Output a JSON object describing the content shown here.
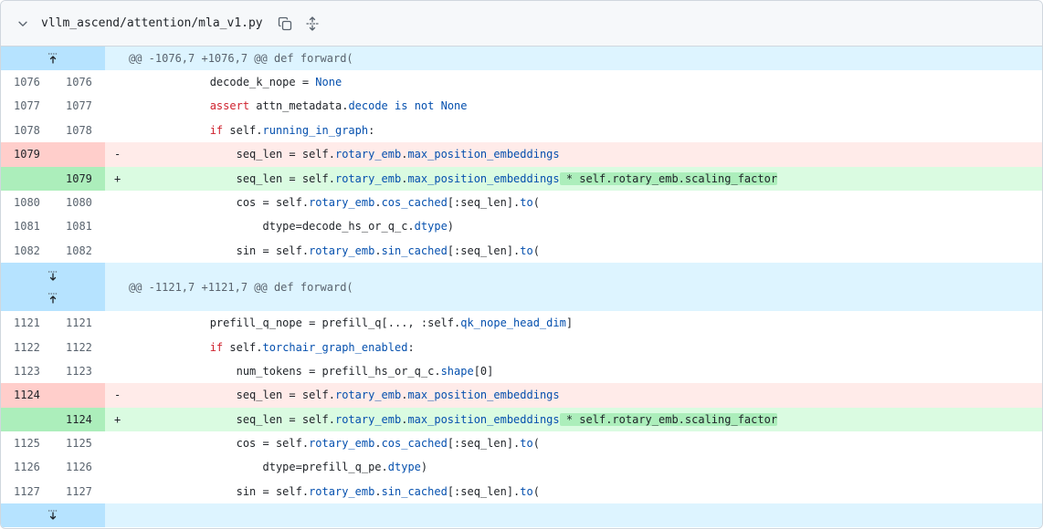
{
  "file": {
    "path": "vllm_ascend/attention/mla_v1.py"
  },
  "icons": {
    "collapse": "chevron-down-icon",
    "copy": "copy-icon",
    "expand": "unfold-icon"
  },
  "hunks": [
    {
      "header": "@@ -1076,7 +1076,7 @@ def forward(",
      "lines": [
        {
          "type": "ctx",
          "old": "1076",
          "new": "1076",
          "sign": "",
          "parts": [
            [
              "",
              "            decode_k_nope "
            ],
            [
              "",
              "= "
            ],
            [
              "bl",
              "None"
            ]
          ]
        },
        {
          "type": "ctx",
          "old": "1077",
          "new": "1077",
          "sign": "",
          "parts": [
            [
              "",
              "            "
            ],
            [
              "kw",
              "assert"
            ],
            [
              "",
              " attn_metadata."
            ],
            [
              "bl",
              "decode"
            ],
            [
              "",
              " "
            ],
            [
              "bl",
              "is not None"
            ]
          ]
        },
        {
          "type": "ctx",
          "old": "1078",
          "new": "1078",
          "sign": "",
          "parts": [
            [
              "",
              "            "
            ],
            [
              "kw",
              "if"
            ],
            [
              "",
              " self."
            ],
            [
              "bl",
              "running_in_graph"
            ],
            [
              "",
              ":"
            ]
          ]
        },
        {
          "type": "del",
          "old": "1079",
          "new": "",
          "sign": "-",
          "parts": [
            [
              "",
              "                seq_len = self."
            ],
            [
              "bl",
              "rotary_emb"
            ],
            [
              "",
              "."
            ],
            [
              "bl",
              "max_position_embeddings"
            ]
          ]
        },
        {
          "type": "add",
          "old": "",
          "new": "1079",
          "sign": "+",
          "parts": [
            [
              "",
              "                seq_len = self."
            ],
            [
              "bl",
              "rotary_emb"
            ],
            [
              "",
              "."
            ],
            [
              "bl",
              "max_position_embeddings"
            ],
            [
              "hl",
              " * self.rotary_emb.scaling_factor"
            ]
          ]
        },
        {
          "type": "ctx",
          "old": "1080",
          "new": "1080",
          "sign": "",
          "parts": [
            [
              "",
              "                cos = self."
            ],
            [
              "bl",
              "rotary_emb"
            ],
            [
              "",
              "."
            ],
            [
              "bl",
              "cos_cached"
            ],
            [
              "",
              "[:seq_len]."
            ],
            [
              "bl",
              "to"
            ],
            [
              "",
              "("
            ]
          ]
        },
        {
          "type": "ctx",
          "old": "1081",
          "new": "1081",
          "sign": "",
          "parts": [
            [
              "",
              "                    dtype=decode_hs_or_q_c."
            ],
            [
              "bl",
              "dtype"
            ],
            [
              "",
              ")"
            ]
          ]
        },
        {
          "type": "ctx",
          "old": "1082",
          "new": "1082",
          "sign": "",
          "parts": [
            [
              "",
              "                sin = self."
            ],
            [
              "bl",
              "rotary_emb"
            ],
            [
              "",
              "."
            ],
            [
              "bl",
              "sin_cached"
            ],
            [
              "",
              "[:seq_len]."
            ],
            [
              "bl",
              "to"
            ],
            [
              "",
              "("
            ]
          ]
        }
      ]
    },
    {
      "header": "@@ -1121,7 +1121,7 @@ def forward(",
      "lines": [
        {
          "type": "ctx",
          "old": "1121",
          "new": "1121",
          "sign": "",
          "parts": [
            [
              "",
              "            prefill_q_nope = prefill_q[..., :self."
            ],
            [
              "bl",
              "qk_nope_head_dim"
            ],
            [
              "",
              "]"
            ]
          ]
        },
        {
          "type": "ctx",
          "old": "1122",
          "new": "1122",
          "sign": "",
          "parts": [
            [
              "",
              "            "
            ],
            [
              "kw",
              "if"
            ],
            [
              "",
              " self."
            ],
            [
              "bl",
              "torchair_graph_enabled"
            ],
            [
              "",
              ":"
            ]
          ]
        },
        {
          "type": "ctx",
          "old": "1123",
          "new": "1123",
          "sign": "",
          "parts": [
            [
              "",
              "                num_tokens = prefill_hs_or_q_c."
            ],
            [
              "bl",
              "shape"
            ],
            [
              "",
              "[0]"
            ]
          ]
        },
        {
          "type": "del",
          "old": "1124",
          "new": "",
          "sign": "-",
          "parts": [
            [
              "",
              "                seq_len = self."
            ],
            [
              "bl",
              "rotary_emb"
            ],
            [
              "",
              "."
            ],
            [
              "bl",
              "max_position_embeddings"
            ]
          ]
        },
        {
          "type": "add",
          "old": "",
          "new": "1124",
          "sign": "+",
          "parts": [
            [
              "",
              "                seq_len = self."
            ],
            [
              "bl",
              "rotary_emb"
            ],
            [
              "",
              "."
            ],
            [
              "bl",
              "max_position_embeddings"
            ],
            [
              "hl",
              " * self.rotary_emb.scaling_factor"
            ]
          ]
        },
        {
          "type": "ctx",
          "old": "1125",
          "new": "1125",
          "sign": "",
          "parts": [
            [
              "",
              "                cos = self."
            ],
            [
              "bl",
              "rotary_emb"
            ],
            [
              "",
              "."
            ],
            [
              "bl",
              "cos_cached"
            ],
            [
              "",
              "[:seq_len]."
            ],
            [
              "bl",
              "to"
            ],
            [
              "",
              "("
            ]
          ]
        },
        {
          "type": "ctx",
          "old": "1126",
          "new": "1126",
          "sign": "",
          "parts": [
            [
              "",
              "                    dtype=prefill_q_pe."
            ],
            [
              "bl",
              "dtype"
            ],
            [
              "",
              ")"
            ]
          ]
        },
        {
          "type": "ctx",
          "old": "1127",
          "new": "1127",
          "sign": "",
          "parts": [
            [
              "",
              "                sin = self."
            ],
            [
              "bl",
              "rotary_emb"
            ],
            [
              "",
              "."
            ],
            [
              "bl",
              "sin_cached"
            ],
            [
              "",
              "[:seq_len]."
            ],
            [
              "bl",
              "to"
            ],
            [
              "",
              "("
            ]
          ]
        }
      ]
    }
  ],
  "colors": {
    "accent": "#0969da",
    "hunk_bg": "#ddf4ff",
    "hunk_gutter": "#b6e3ff",
    "del_bg": "#ffebe9",
    "del_num": "#ffcecb",
    "add_bg": "#dafbe1",
    "add_num": "#aceebb",
    "keyword": "#cf222e",
    "builtin": "#0550ae"
  }
}
